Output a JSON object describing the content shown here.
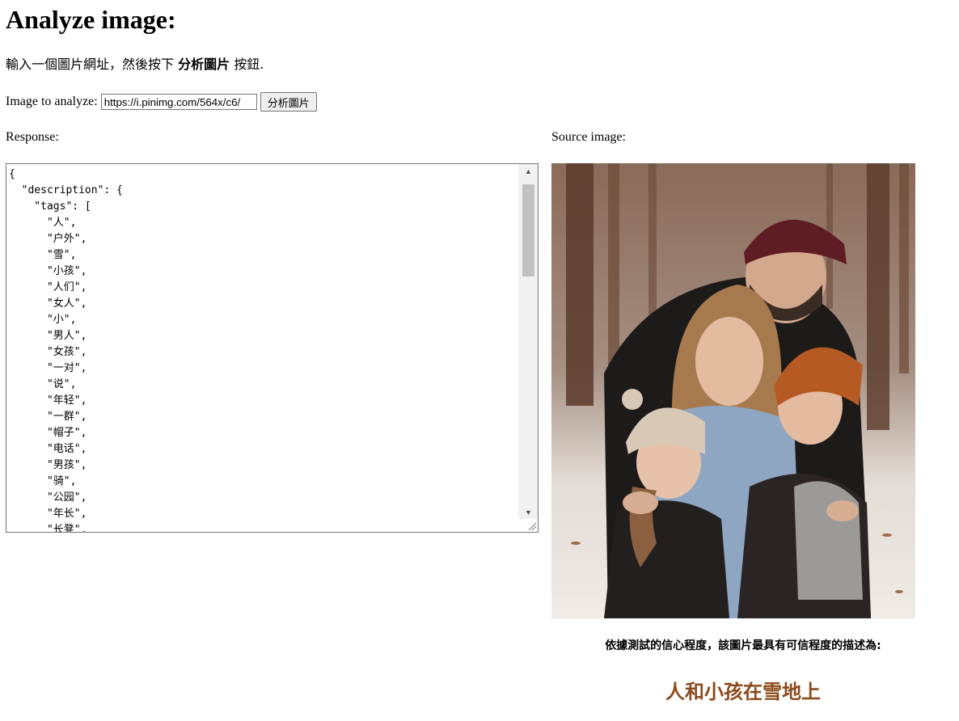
{
  "page": {
    "title": "Analyze image:",
    "instructions": {
      "before": "輸入一個圖片網址，然後按下 ",
      "button_ref": "分析圖片",
      "after": " 按鈕."
    }
  },
  "form": {
    "label": "Image to analyze:",
    "url_value": "https://i.pinimg.com/564x/c6/",
    "button_label": "分析圖片"
  },
  "response": {
    "label": "Response:",
    "lines": [
      "{",
      "  \"description\": {",
      "    \"tags\": [",
      "      \"人\",",
      "      \"户外\",",
      "      \"雪\",",
      "      \"小孩\",",
      "      \"人们\",",
      "      \"女人\",",
      "      \"小\",",
      "      \"男人\",",
      "      \"女孩\",",
      "      \"一对\",",
      "      \"说\",",
      "      \"年轻\",",
      "      \"一群\",",
      "      \"帽子\",",
      "      \"电话\",",
      "      \"男孩\",",
      "      \"骑\",",
      "      \"公园\",",
      "      \"年长\",",
      "      \"长凳\","
    ]
  },
  "source": {
    "label": "Source image:",
    "caption_intro": "依據測試的信心程度，該圖片最具有可信程度的描述為:",
    "caption": "人和小孩在雪地上"
  },
  "colors": {
    "caption": "#8b4a1c",
    "scroll_thumb": "#c1c1c1",
    "scroll_track": "#f1f1f1"
  }
}
